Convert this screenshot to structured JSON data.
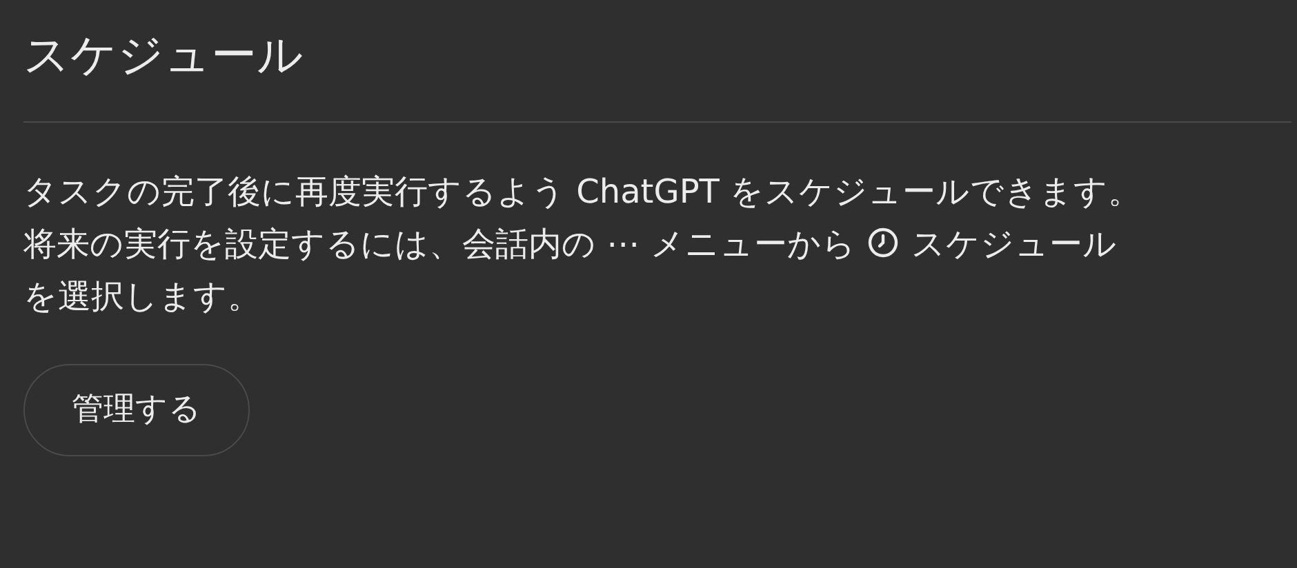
{
  "title": "スケジュール",
  "description": {
    "sentence": "タスクの完了後に再度実行するよう ChatGPT をスケジュールできます。",
    "before_icon": "将来の実行を設定するには、会話内の ⋯ メニューから",
    "after_icon": "スケジュール",
    "last_line": "を選択します。"
  },
  "button": {
    "label": "管理する"
  }
}
